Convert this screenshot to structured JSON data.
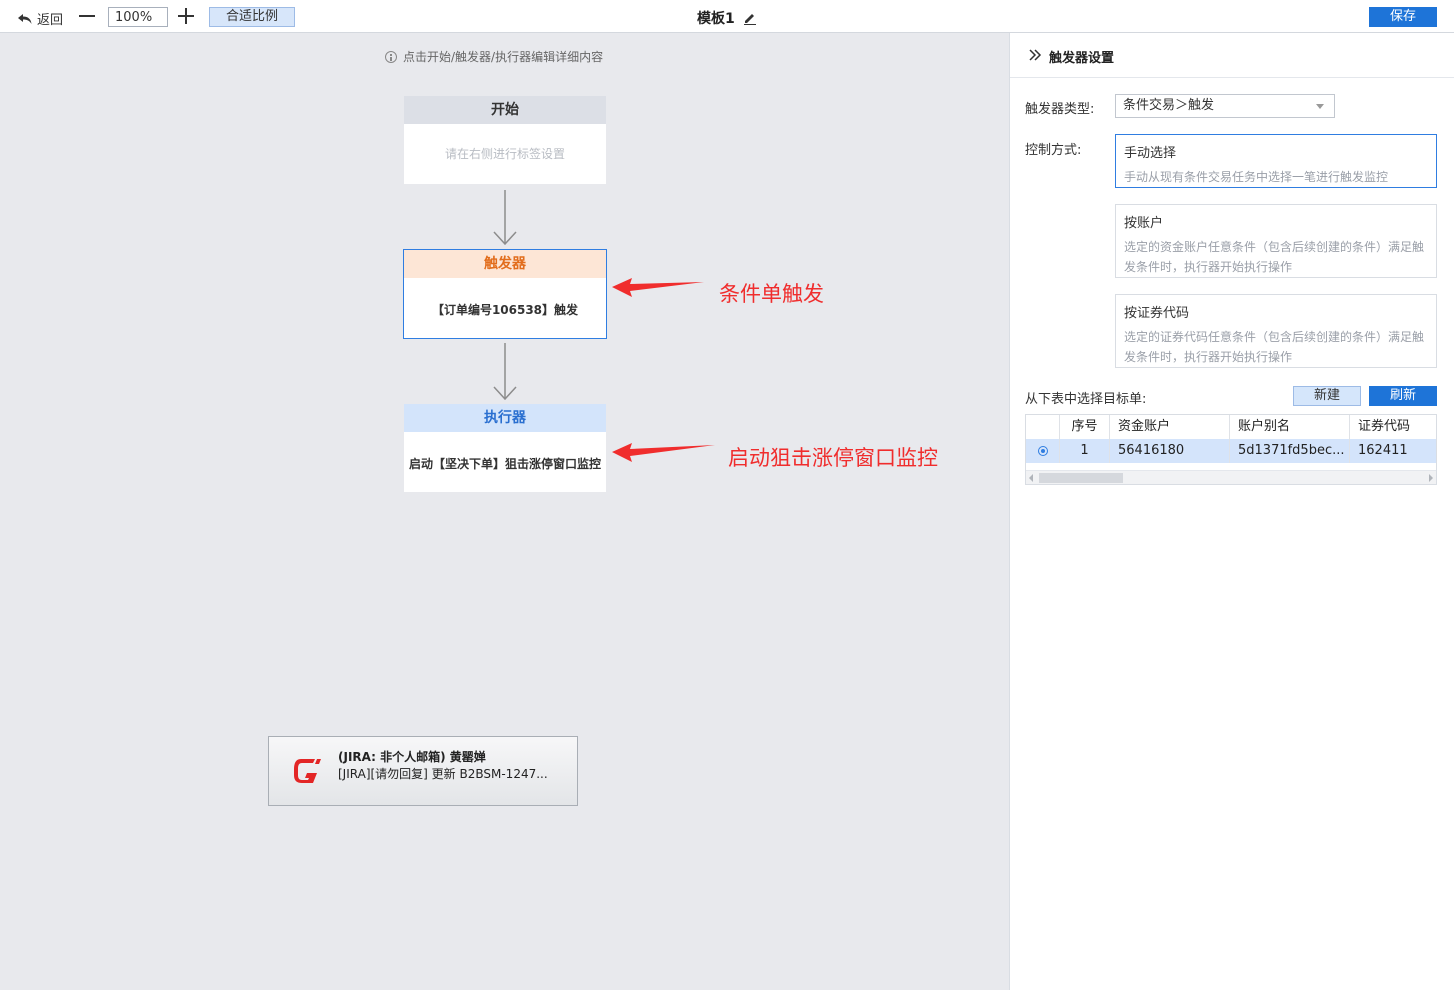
{
  "toolbar": {
    "back_label": "返回",
    "zoom_value": "100%",
    "fit_label": "合适比例",
    "title": "模板1",
    "save_label": "保存"
  },
  "canvas": {
    "hint": "点击开始/触发器/执行器编辑详细内容",
    "nodes": {
      "start": {
        "title": "开始",
        "body": "请在右侧进行标签设置"
      },
      "trigger": {
        "title": "触发器",
        "body": "【订单编号106538】触发"
      },
      "executor": {
        "title": "执行器",
        "body": "启动【坚决下单】狙击涨停窗口监控"
      }
    },
    "annotations": {
      "trigger": "条件单触发",
      "executor": "启动狙击涨停窗口监控"
    },
    "notification": {
      "title": "(JIRA: 非个人邮箱) 黄罂婵",
      "text": "[JIRA][请勿回复] 更新 B2BSM-1247..."
    }
  },
  "panel": {
    "title": "触发器设置",
    "trigger_type_label": "触发器类型:",
    "trigger_type_value": "条件交易＞触发",
    "control_label": "控制方式:",
    "options": [
      {
        "title": "手动选择",
        "desc": "手动从现有条件交易任务中选择一笔进行触发监控",
        "active": true
      },
      {
        "title": "按账户",
        "desc": "选定的资金账户任意条件（包含后续创建的条件）满足触发条件时，执行器开始执行操作",
        "active": false
      },
      {
        "title": "按证券代码",
        "desc": "选定的证券代码任意条件（包含后续创建的条件）满足触发条件时，执行器开始执行操作",
        "active": false
      }
    ],
    "select_target_label": "从下表中选择目标单:",
    "new_label": "新建",
    "refresh_label": "刷新",
    "table": {
      "headers": [
        "序号",
        "资金账户",
        "账户别名",
        "证券代码"
      ],
      "rows": [
        {
          "selected": true,
          "cells": [
            "1",
            "56416180",
            "5d1371fd5bec...",
            "162411"
          ]
        }
      ]
    }
  },
  "colors": {
    "primary": "#1e74d8",
    "annotation_red": "#f02d2d",
    "trigger_orange": "#e26d1c",
    "executor_blue": "#2a6fd0"
  }
}
